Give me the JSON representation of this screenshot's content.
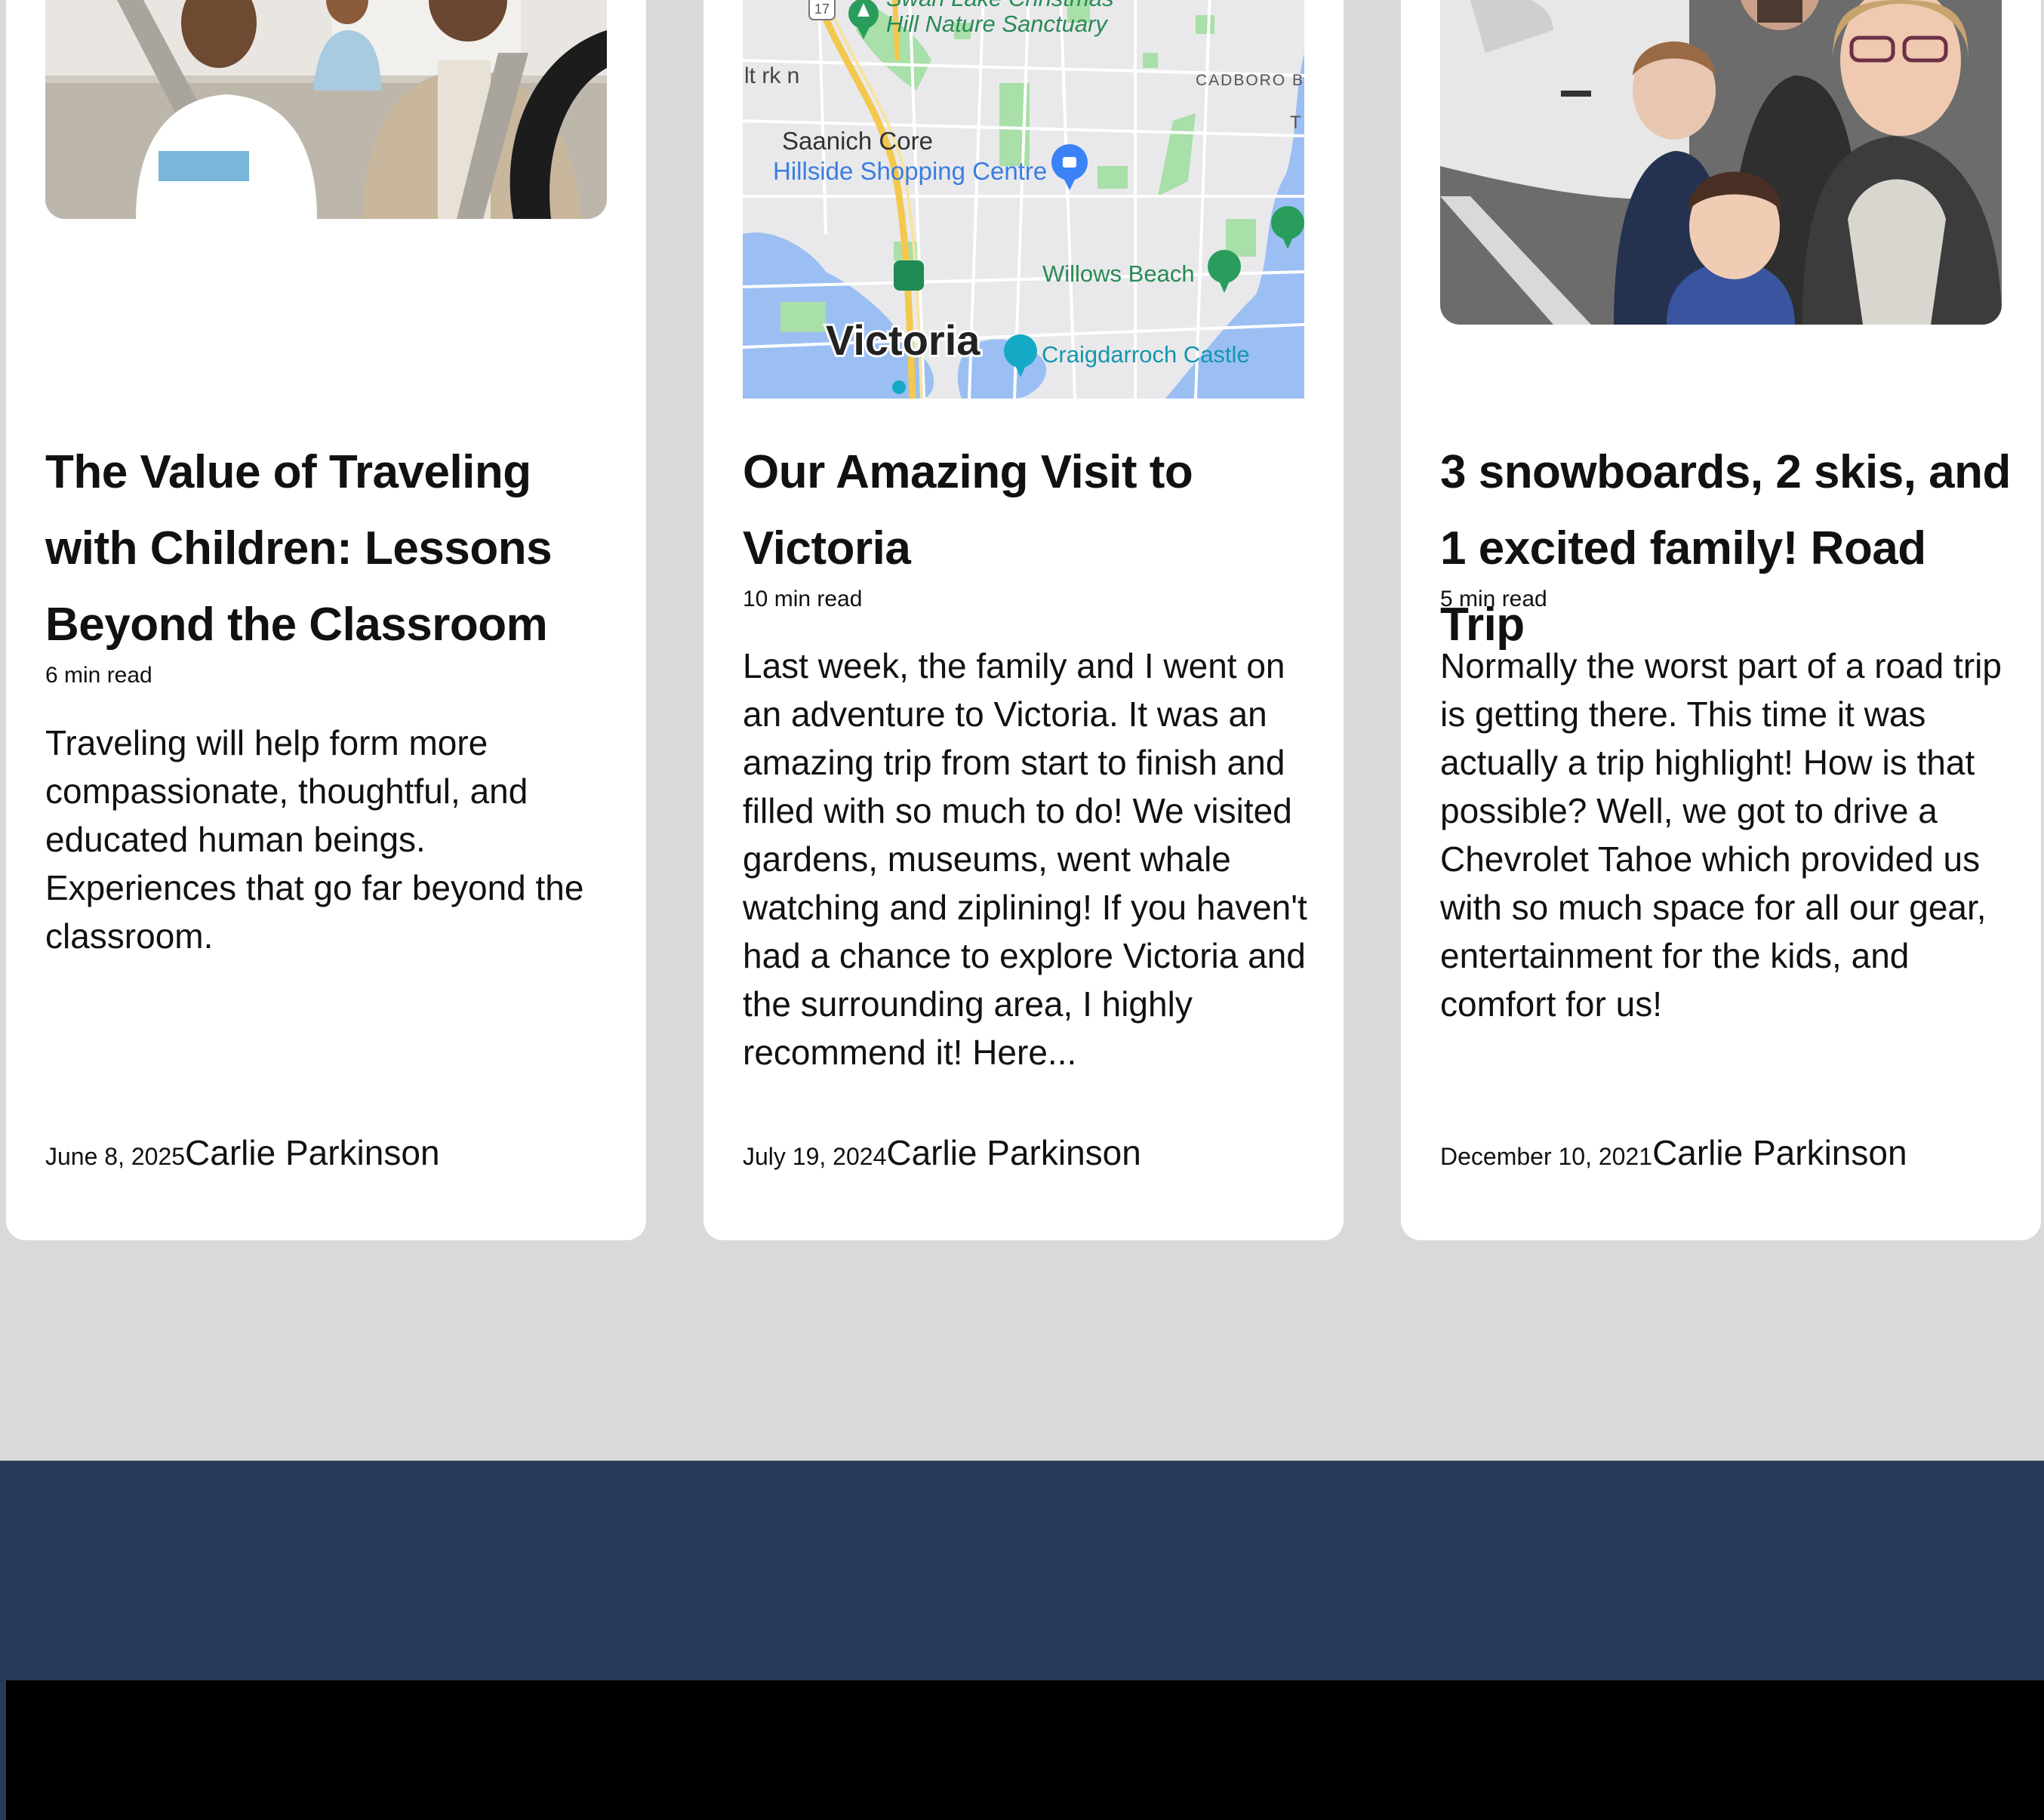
{
  "posts": [
    {
      "title": "The Value of Traveling with Children: Lessons Beyond the Classroom",
      "read_time": "6 min read",
      "excerpt": "Traveling will help form more compassionate, thoughtful, and educated human beings. Experiences that go far beyond the classroom.",
      "date": "June 8, 2025",
      "author": "Carlie Parkinson",
      "image": "family-in-car-photo"
    },
    {
      "title": "Our Amazing Visit to Victoria",
      "read_time": "10 min read",
      "excerpt": "Last week, the family and I went on an adventure to Victoria. It was an amazing trip from start to finish and filled with so much to do! We visited gardens, museums, went whale watching and ziplining! If you haven't had a chance to explore Victoria and the surrounding area, I highly recommend it! Here...",
      "date": "July 19, 2024",
      "author": "Carlie Parkinson",
      "image": "victoria-map",
      "map_labels": {
        "sanctuary_line1": "Swan Lake Christmas",
        "sanctuary_line2": "Hill Nature Sanctuary",
        "highway": "17",
        "saanich": "Saanich Core",
        "mall": "Hillside Shopping Centre",
        "beach": "Willows Beach",
        "city": "Victoria",
        "castle": "Craigdarroch Castle",
        "cadboro": "CADBORO BA",
        "park_fragment": "lt rk n",
        "t_fragment": "T"
      }
    },
    {
      "title": "3 snowboards, 2 skis, and 1 excited family! Road Trip",
      "read_time": "5 min read",
      "excerpt": "Normally the worst part of a road trip is getting there. This time it was actually a trip highlight! How is that possible? Well, we got to drive a Chevrolet Tahoe which provided us with so much space for all our gear, entertainment for the kids, and comfort for us!",
      "date": "December 10, 2021",
      "author": "Carlie Parkinson",
      "image": "family-by-suv-photo"
    }
  ],
  "colors": {
    "page_bg": "#d9d9d9",
    "card_bg": "#ffffff",
    "footer_blue": "#273b5a",
    "footer_black": "#000000"
  }
}
